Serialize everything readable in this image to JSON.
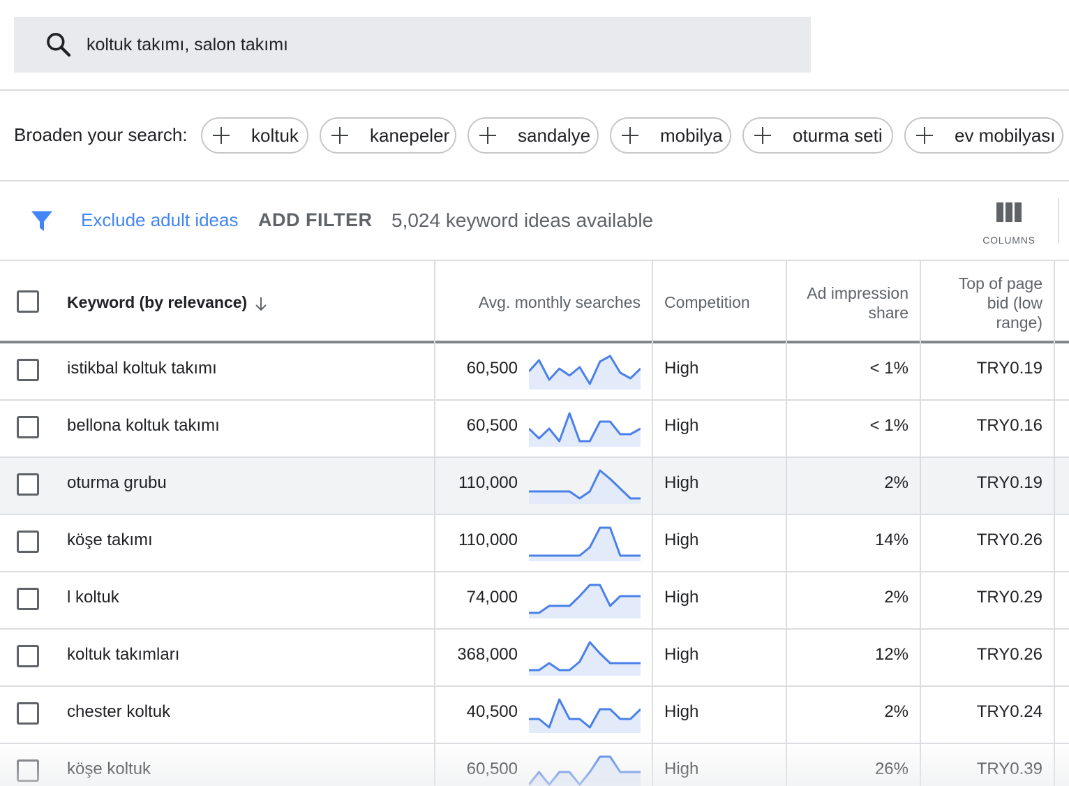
{
  "search": {
    "icon": "search-icon",
    "value": "koltuk takımı, salon takımı"
  },
  "broaden": {
    "label": "Broaden your search:",
    "chips": [
      {
        "label": "koltuk"
      },
      {
        "label": "kanepeler"
      },
      {
        "label": "sandalye"
      },
      {
        "label": "mobilya"
      },
      {
        "label": "oturma seti"
      },
      {
        "label": "ev mobilyası"
      }
    ]
  },
  "toolbar": {
    "filter_icon": "filter-icon",
    "exclude_label": "Exclude adult ideas",
    "add_filter_label": "ADD FILTER",
    "ideas_count": "5,024 keyword ideas available",
    "columns_label": "COLUMNS",
    "link_color": "#4285f4"
  },
  "table": {
    "headers": {
      "keyword": "Keyword (by relevance)",
      "searches": "Avg. monthly searches",
      "competition": "Competition",
      "impression_line1": "Ad impression",
      "impression_line2": "share",
      "bid_line1": "Top of page",
      "bid_line2": "bid (low",
      "bid_line3": "range)"
    },
    "sort": "descending",
    "trend_color": "#4a80e8",
    "rows": [
      {
        "keyword": "istikbal koltuk takımı",
        "searches": "60,500",
        "competition": "High",
        "impression": "< 1%",
        "bid": "TRY0.19",
        "trend": [
          0.45,
          0.85,
          0.15,
          0.55,
          0.3,
          0.6,
          0.0,
          0.8,
          1.0,
          0.4,
          0.2,
          0.55
        ]
      },
      {
        "keyword": "bellona koltuk takımı",
        "searches": "60,500",
        "competition": "High",
        "impression": "< 1%",
        "bid": "TRY0.16",
        "trend": [
          0.45,
          0.1,
          0.45,
          0.0,
          1.0,
          0.0,
          0.0,
          0.7,
          0.7,
          0.25,
          0.25,
          0.45
        ]
      },
      {
        "keyword": "oturma grubu",
        "searches": "110,000",
        "competition": "High",
        "impression": "2%",
        "bid": "TRY0.19",
        "trend": [
          0.25,
          0.25,
          0.25,
          0.25,
          0.25,
          0.0,
          0.25,
          1.0,
          0.7,
          0.35,
          0.0,
          0.0
        ],
        "highlighted": true
      },
      {
        "keyword": "köşe takımı",
        "searches": "110,000",
        "competition": "High",
        "impression": "14%",
        "bid": "TRY0.26",
        "trend": [
          0.0,
          0.0,
          0.0,
          0.0,
          0.0,
          0.0,
          0.3,
          1.0,
          1.0,
          0.0,
          0.0,
          0.0
        ]
      },
      {
        "keyword": "l koltuk",
        "searches": "74,000",
        "competition": "High",
        "impression": "2%",
        "bid": "TRY0.29",
        "trend": [
          0.0,
          0.0,
          0.25,
          0.25,
          0.25,
          0.6,
          1.0,
          1.0,
          0.25,
          0.6,
          0.6,
          0.6
        ]
      },
      {
        "keyword": "koltuk takımları",
        "searches": "368,000",
        "competition": "High",
        "impression": "12%",
        "bid": "TRY0.26",
        "trend": [
          0.0,
          0.0,
          0.25,
          0.0,
          0.0,
          0.3,
          1.0,
          0.6,
          0.25,
          0.25,
          0.25,
          0.25
        ]
      },
      {
        "keyword": "chester koltuk",
        "searches": "40,500",
        "competition": "High",
        "impression": "2%",
        "bid": "TRY0.24",
        "trend": [
          0.3,
          0.3,
          0.0,
          1.0,
          0.3,
          0.3,
          0.0,
          0.65,
          0.65,
          0.3,
          0.3,
          0.65
        ]
      },
      {
        "keyword": "köşe koltuk",
        "searches": "60,500",
        "competition": "High",
        "impression": "26%",
        "bid": "TRY0.39",
        "trend": [
          0.0,
          0.45,
          0.0,
          0.45,
          0.45,
          0.0,
          0.45,
          1.0,
          1.0,
          0.45,
          0.45,
          0.45
        ]
      }
    ]
  }
}
